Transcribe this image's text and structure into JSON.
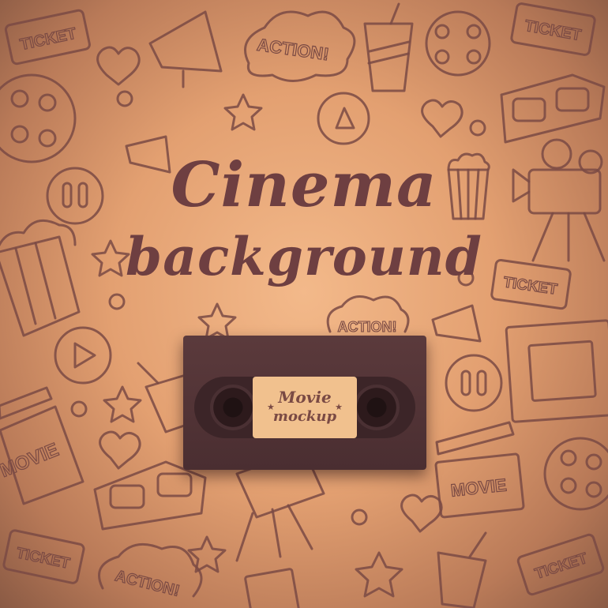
{
  "title": {
    "line1": "Cinema",
    "line2": "background"
  },
  "cassette_label": {
    "line1": "Movie",
    "line2": "mockup"
  },
  "doodle_words": {
    "ticket": "TICKET",
    "action": "ACTION!",
    "movie": "MOVIE"
  },
  "colors": {
    "ink": "#6e3f41",
    "doodle": "#7a4a44",
    "background": "#e3a071",
    "label": "#f1c18e",
    "cassette": "#4a2e31"
  },
  "icons": [
    "ticket-icon",
    "megaphone-icon",
    "cup-icon",
    "film-reel-icon",
    "3d-glasses-icon",
    "heart-icon",
    "star-icon",
    "play-button-icon",
    "popcorn-icon",
    "movie-camera-icon",
    "clapperboard-icon",
    "film-strip-icon",
    "pause-button-icon"
  ]
}
